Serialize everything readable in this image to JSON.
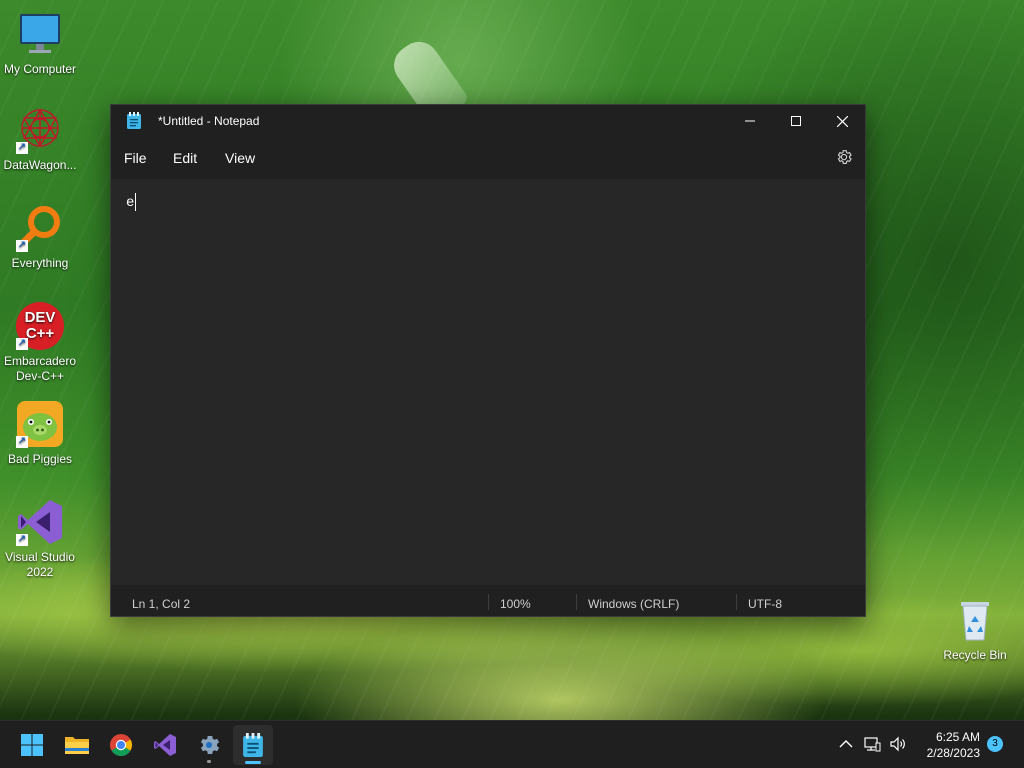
{
  "desktop": {
    "icons": [
      {
        "label": "My Computer"
      },
      {
        "label": "DataWagon..."
      },
      {
        "label": "Everything"
      },
      {
        "label": "Embarcadero Dev-C++",
        "glyph_text": "DEV\nC++"
      },
      {
        "label": "Bad Piggies"
      },
      {
        "label": "Visual Studio 2022"
      },
      {
        "label": "Recycle Bin"
      }
    ]
  },
  "notepad": {
    "title": "*Untitled - Notepad",
    "menu": {
      "file": "File",
      "edit": "Edit",
      "view": "View"
    },
    "content": "e",
    "status": {
      "position": "Ln 1, Col 2",
      "zoom": "100%",
      "line_ending": "Windows (CRLF)",
      "encoding": "UTF-8"
    }
  },
  "taskbar": {
    "apps": [
      "start",
      "file-explorer",
      "chrome",
      "visual-studio",
      "settings",
      "notepad"
    ],
    "active_app": "notepad",
    "clock": {
      "time": "6:25 AM",
      "date": "2/28/2023"
    },
    "notification_count": "3"
  },
  "colors": {
    "window_bg": "#202020",
    "editor_bg": "#272727",
    "accent": "#4cc2ff",
    "taskbar_bg": "#1f1f1f"
  }
}
